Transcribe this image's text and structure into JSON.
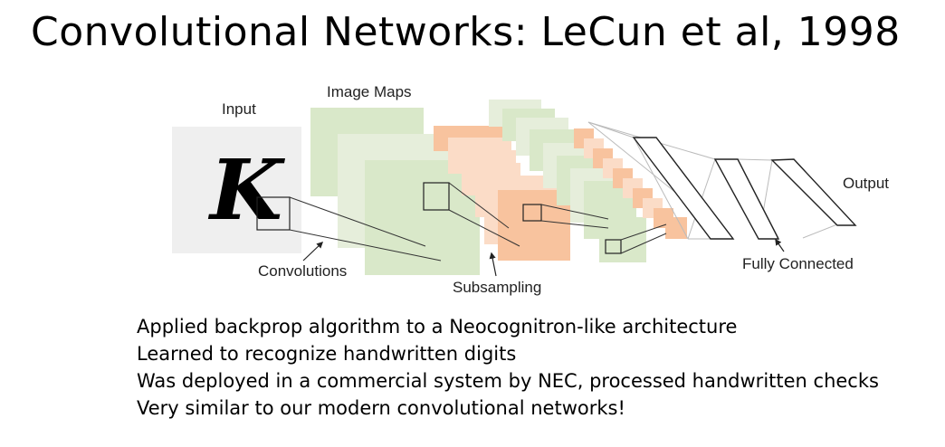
{
  "title": "Convolutional Networks: LeCun et al, 1998",
  "diagram": {
    "input_label": "Input",
    "input_glyph": "K",
    "image_maps_label": "Image Maps",
    "output_label": "Output",
    "convolutions_label": "Convolutions",
    "subsampling_label": "Subsampling",
    "fully_connected_label": "Fully Connected",
    "colors": {
      "input_bg": "#efefef",
      "green": "#d9e8c9",
      "green_light": "#e6eedb",
      "orange": "#f8c39e",
      "orange_light": "#fbdcc7"
    }
  },
  "bullets": [
    "Applied backprop algorithm to a Neocognitron-like architecture",
    "Learned to recognize handwritten digits",
    "Was deployed in a commercial system by NEC, processed handwritten checks",
    "Very similar to our modern convolutional networks!"
  ]
}
